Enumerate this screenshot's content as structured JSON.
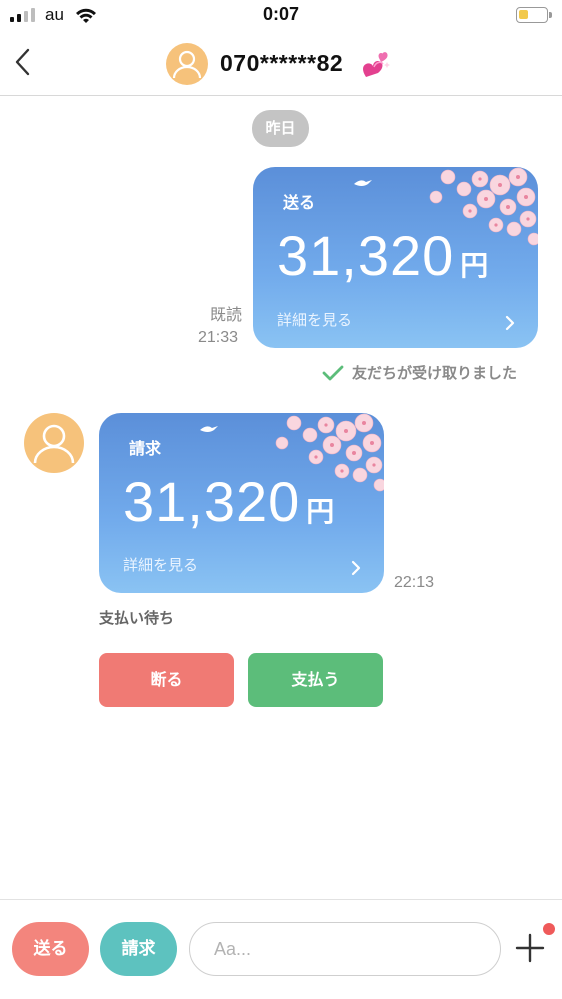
{
  "status_bar": {
    "carrier": "au",
    "time": "0:07"
  },
  "header": {
    "title": "070******82",
    "title_emoji_icon": "sparkling-heart-icon",
    "back_icon": "chevron-left-icon"
  },
  "date_separator": "昨日",
  "sent_message": {
    "label": "送る",
    "amount": "31,320",
    "unit": "円",
    "detail_link": "詳細を見る",
    "read_label": "既読",
    "time": "21:33",
    "status": "友だちが受け取りました"
  },
  "received_message": {
    "label": "請求",
    "amount": "31,320",
    "unit": "円",
    "detail_link": "詳細を見る",
    "time": "22:13",
    "status": "支払い待ち"
  },
  "actions": {
    "decline": "断る",
    "pay": "支払う"
  },
  "footer": {
    "send": "送る",
    "request": "請求",
    "input_placeholder": "Aa..."
  },
  "colors": {
    "card_gradient_top": "#5b8fd9",
    "card_gradient_bottom": "#8ac3f3",
    "decline": "#f07a74",
    "pay": "#5cbd7a",
    "send_pill": "#f3857d",
    "request_pill": "#5dc2bf",
    "avatar": "#f6c27b",
    "check": "#5cbd7a",
    "notification_dot": "#ef5a5a"
  }
}
